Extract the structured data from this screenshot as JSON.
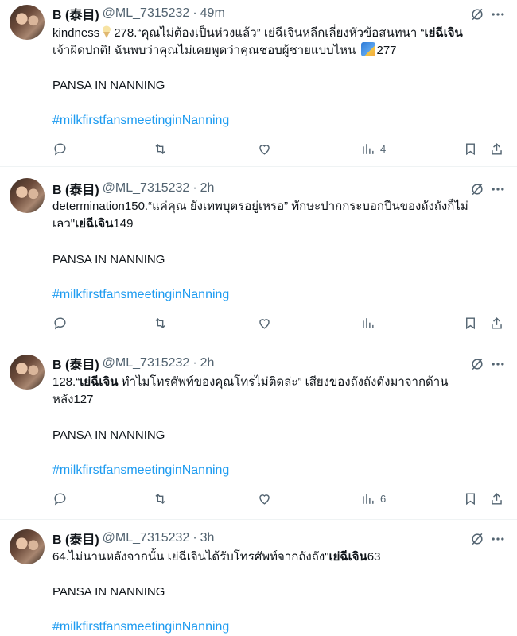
{
  "tweets": [
    {
      "name": "B (泰目)",
      "handle": "@ML_7315232",
      "time": "49m",
      "line1_pre": "kindness",
      "line1_mid": "278.“คุณไม่ต้องเป็นห่วงแล้ว” เย่ฉีเจินหลีกเลี่ยงหัวข้อสนทนา “",
      "line1_bold": "เย่ฉีเจิน",
      "line2_pre": "เจ้าผิดปกติ! ฉันพบว่าคุณไม่เคยพูดว่าคุณชอบผู้ชายแบบไหน",
      "line2_post": "277",
      "location": "PANSA IN NANNING",
      "hashtag": "#milkfirstfansmeetinginNanning",
      "views": "4"
    },
    {
      "name": "B (泰目)",
      "handle": "@ML_7315232",
      "time": "2h",
      "line1": "determination150.“แค่คุณ ยังเทพบุตรอยู่เหรอ” ทักษะปากกระบอกปืนของถังถังก็ไม่",
      "line2_pre": "เลว\"",
      "line2_bold": "เย่ฉีเจิน",
      "line2_post": "149",
      "location": "PANSA IN NANNING",
      "hashtag": "#milkfirstfansmeetinginNanning",
      "views": ""
    },
    {
      "name": "B (泰目)",
      "handle": "@ML_7315232",
      "time": "2h",
      "line1_pre": "128.“",
      "line1_bold": "เย่ฉีเจิน",
      "line1_post": " ทำไมโทรศัพท์ของคุณโทรไม่ติดล่ะ” เสียงของถังถังดังมาจากด้าน",
      "line2": "หลัง127",
      "location": "PANSA IN NANNING",
      "hashtag": "#milkfirstfansmeetinginNanning",
      "views": "6"
    },
    {
      "name": "B (泰目)",
      "handle": "@ML_7315232",
      "time": "3h",
      "line1_pre": "64.ไม่นานหลังจากนั้น เย่ฉีเจินได้รับโทรศัพท์จากถังถัง\"",
      "line1_bold": "เย่ฉีเจิน",
      "line1_post": "63",
      "location": "PANSA IN NANNING",
      "hashtag": "#milkfirstfansmeetinginNanning"
    }
  ],
  "icons": {
    "reply": "reply-icon",
    "retweet": "retweet-icon",
    "like": "like-icon",
    "views": "views-icon",
    "bookmark": "bookmark-icon",
    "share": "share-icon",
    "grok": "grok-icon",
    "more": "more-icon"
  },
  "colors": {
    "text": "#0f1419",
    "muted": "#536471",
    "link": "#1d9bf0",
    "divider": "#eff3f4"
  }
}
